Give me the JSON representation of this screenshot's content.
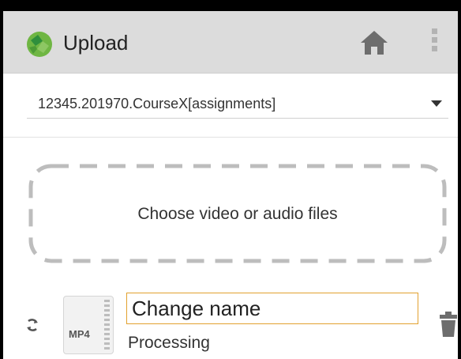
{
  "appbar": {
    "title": "Upload",
    "logo_icon": "kaltura-logo-icon",
    "home_icon": "home-icon",
    "overflow_icon": "more-vert-icon",
    "bar_color": "#dcdcdc"
  },
  "course_select": {
    "value": "12345.201970.CourseX[assignments]",
    "arrow_icon": "dropdown-arrow-icon"
  },
  "dropzone": {
    "label": "Choose video or audio files"
  },
  "file": {
    "type_label": "MP4",
    "name_value": "Change name",
    "status": "Processing",
    "refresh_icon": "refresh-icon",
    "delete_icon": "trash-icon",
    "input_border_color": "#e2a12f"
  }
}
